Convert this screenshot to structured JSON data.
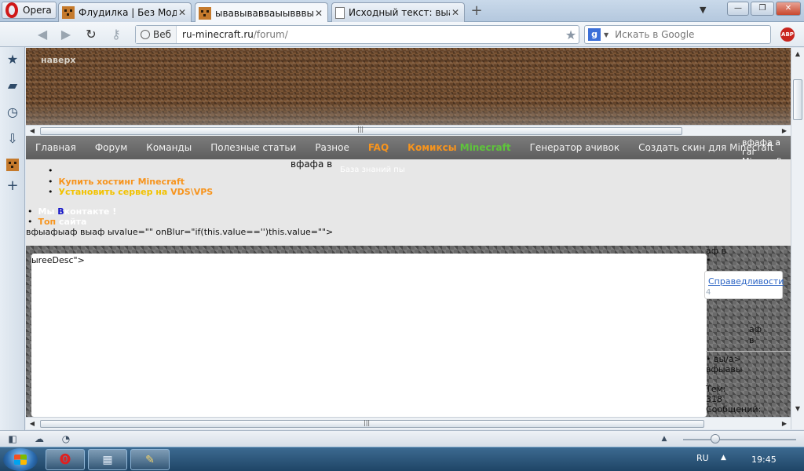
{
  "browser": {
    "menu_button_label": "Opera",
    "tabs": [
      {
        "title": "Флудилка | Без Модер...",
        "icon": "creeper-icon",
        "active": false
      },
      {
        "title": "ывавывавваыывввы",
        "icon": "creeper-icon",
        "active": true
      },
      {
        "title": "Исходный текст: выав...",
        "icon": "page-icon",
        "active": false
      }
    ],
    "tab_close_glyph": "✕",
    "new_tab_glyph": "+",
    "tab_menu_glyph": "▼",
    "window_controls": {
      "minimize": "—",
      "maximize": "❐",
      "close": "✕"
    }
  },
  "navigation": {
    "address_scope_label": "Веб",
    "url_host": "ru-minecraft.ru",
    "url_path": "/forum/",
    "search_placeholder": "Искать в Google",
    "search_engine_glyph": "g",
    "adblock_label": "ABP"
  },
  "page": {
    "top_link": "наверх",
    "menu": [
      "Главная",
      "Форум",
      "Команды",
      "Полезные статьи",
      "Разное",
      "FAQ"
    ],
    "menu_comics_1": "Комиксы",
    "menu_comics_2": "Minecraft",
    "menu_tail": [
      "Генератор ачивок",
      "Создать скин для Minecraft"
    ],
    "menu_overflow": "вфафа а гаг Minecraft",
    "stray_1": "вфафа в",
    "stray_2": "База знаний пы",
    "list_hosting": "Купить хостинг Minecraft",
    "list_server_1": "Установить сервер на",
    "list_server_2": "VDS\\VPS",
    "list_vk_1": "Мы",
    "list_vk_2": "В",
    "list_vk_3": "контакте !",
    "list_top_1": "Топ",
    "list_top_2": "сайта",
    "broken_code": "вфыафыаф выаф ыvalue=\"\" onBlur=\"if(this.value=='')this.value=\"\">",
    "broken_code_2": "ыreeDesc\">",
    "right_col": {
      "a": "аф в",
      "bullet": "•",
      "link": "Справедливости",
      "digit": "4",
      "b1": "аф",
      "b2": "в",
      "c1": "вы/а>",
      "c2": "вфыавы",
      "stats_1": "Тем:",
      "stats_2": "318",
      "stats_3": "Сообщений:"
    }
  },
  "statusbar": {
    "grip": "|||"
  },
  "taskbar": {
    "lang": "RU",
    "tray_up": "▲",
    "clock": "19:45"
  }
}
